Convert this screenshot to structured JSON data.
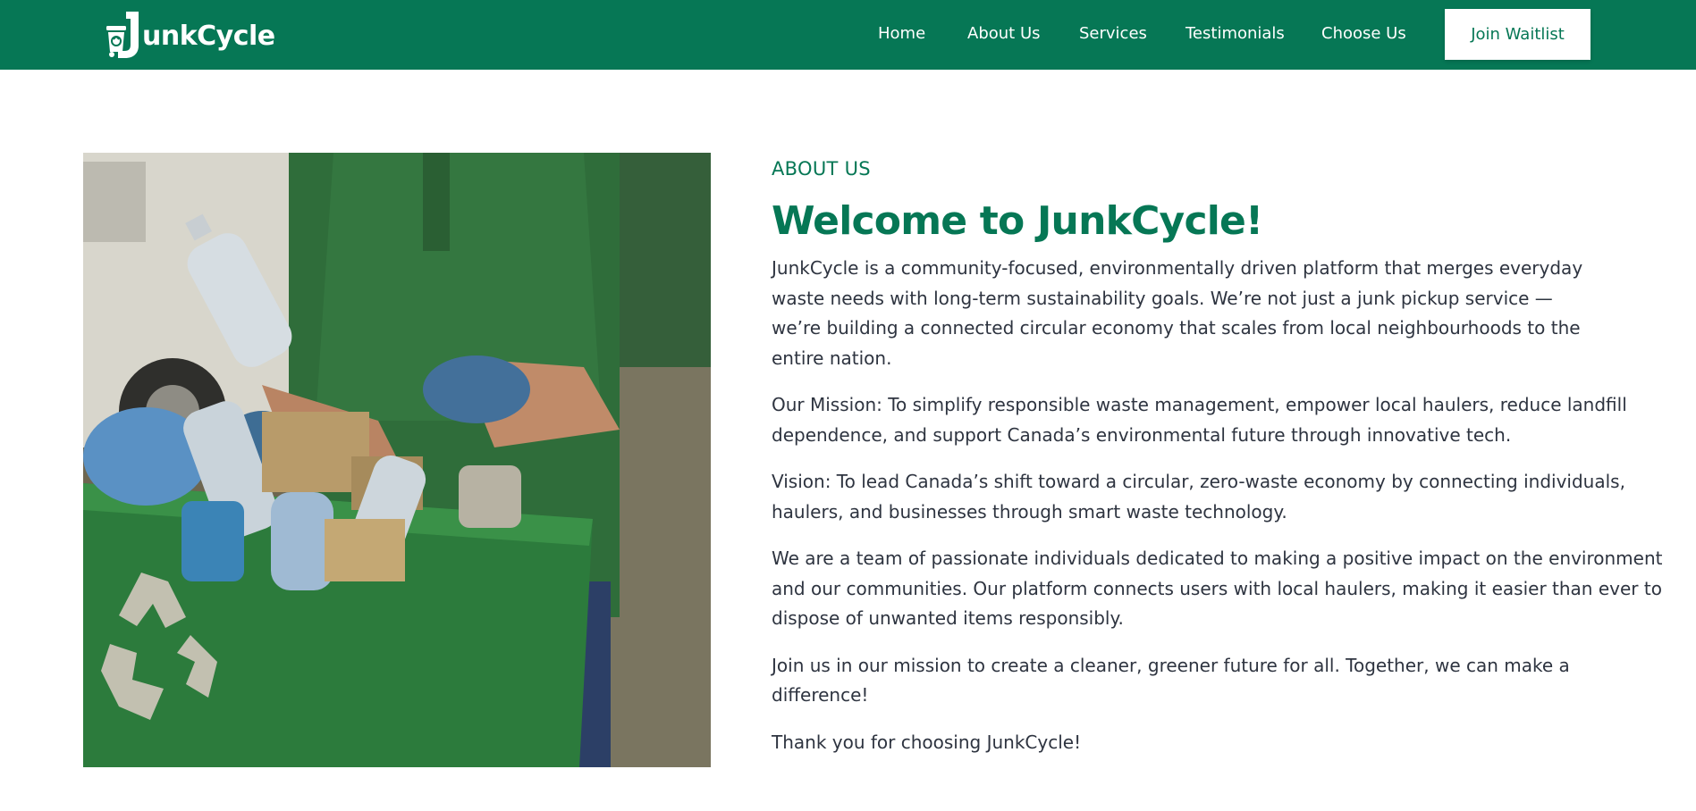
{
  "header": {
    "logo_text": "unkCycle",
    "logo_initial": "J",
    "nav": [
      {
        "label": "Home"
      },
      {
        "label": "About Us"
      },
      {
        "label": "Services"
      },
      {
        "label": "Testimonials"
      },
      {
        "label": "Choose Us"
      }
    ],
    "cta_label": "Join Waitlist"
  },
  "about": {
    "eyebrow": "ABOUT US",
    "title": "Welcome to JunkCycle!",
    "paragraphs": [
      "JunkCycle is a community-focused, environmentally driven platform that merges everyday waste needs with long-term sustainability goals. We’re not just a junk pickup service — we’re building a connected circular economy that scales from local neighbourhoods to the entire nation.",
      "Our Mission: To simplify responsible waste management, empower local haulers, reduce landfill dependence, and support Canada’s environmental future through innovative tech.",
      "Vision: To lead Canada’s shift toward a circular, zero-waste economy by connecting individuals, haulers, and businesses through smart waste technology.",
      "We are a team of passionate individuals dedicated to making a positive impact on the environment and our communities. Our platform connects users with local haulers, making it easier than ever to dispose of unwanted items responsibly.",
      "Join us in our mission to create a cleaner, greener future for all. Together, we can make a difference!",
      "Thank you for choosing JunkCycle!"
    ]
  },
  "colors": {
    "brand_green": "#067755",
    "white": "#ffffff",
    "body_text": "#2e3440"
  },
  "icons": {
    "logo": "junk-bin-recycle-icon",
    "photo": "recycling-bin-worker-photo"
  }
}
